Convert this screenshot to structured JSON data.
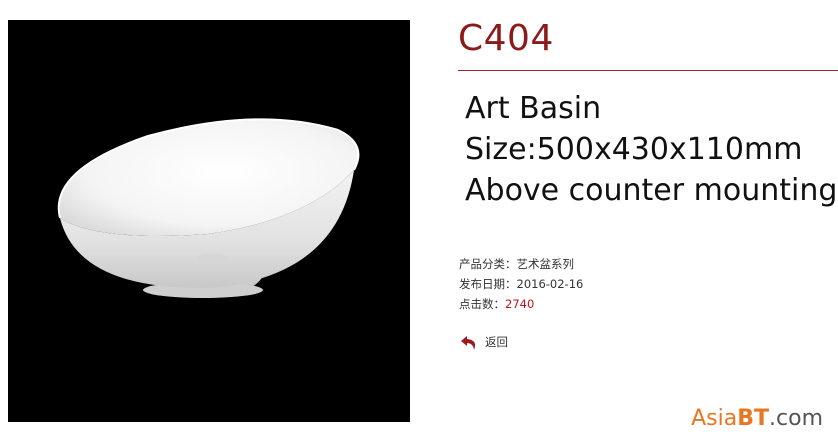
{
  "product": {
    "code": "C404",
    "description_lines": [
      "Art Basin",
      "Size:500x430x110mm",
      "Above counter mounting"
    ]
  },
  "meta": {
    "category_label": "产品分类：",
    "category_value": "艺术盆系列",
    "date_label": "发布日期：",
    "date_value": "2016-02-16",
    "clicks_label": "点击数：",
    "clicks_value": "2740"
  },
  "back": {
    "label": "返回",
    "icon": "back-arrow-icon"
  },
  "watermark": {
    "part1": "Asia",
    "part2": "BT",
    "part3": ".com"
  },
  "colors": {
    "title": "#8b1a1a",
    "accent_red": "#c0141c",
    "watermark_orange": "#e87722",
    "image_bg": "#000000"
  }
}
